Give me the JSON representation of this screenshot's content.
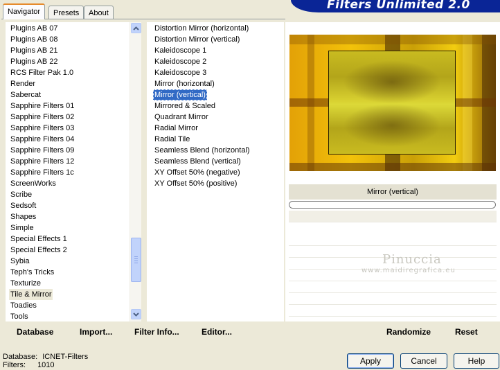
{
  "window": {
    "banner_title": "Filters Unlimited 2.0"
  },
  "tabs": [
    {
      "label": "Navigator",
      "active": true
    },
    {
      "label": "Presets",
      "active": false
    },
    {
      "label": "About",
      "active": false
    }
  ],
  "categories": {
    "items": [
      "Plugins AB 07",
      "Plugins AB 08",
      "Plugins AB 21",
      "Plugins AB 22",
      "RCS Filter Pak 1.0",
      "Render",
      "Sabercat",
      "Sapphire Filters 01",
      "Sapphire Filters 02",
      "Sapphire Filters 03",
      "Sapphire Filters 04",
      "Sapphire Filters 09",
      "Sapphire Filters 12",
      "Sapphire Filters 1c",
      "ScreenWorks",
      "Scribe",
      "Sedsoft",
      "Shapes",
      "Simple",
      "Special Effects 1",
      "Special Effects 2",
      "Sybia",
      "Teph's Tricks",
      "Texturize",
      "Tile & Mirror",
      "Toadies",
      "Tools"
    ],
    "selected": "Tile & Mirror"
  },
  "filters": {
    "items": [
      "Distortion Mirror (horizontal)",
      "Distortion Mirror (vertical)",
      "Kaleidoscope 1",
      "Kaleidoscope 2",
      "Kaleidoscope 3",
      "Mirror (horizontal)",
      "Mirror (vertical)",
      "Mirrored & Scaled",
      "Quadrant Mirror",
      "Radial Mirror",
      "Radial Tile",
      "Seamless Blend (horizontal)",
      "Seamless Blend (vertical)",
      "XY Offset 50% (negative)",
      "XY Offset 50% (positive)"
    ],
    "selected": "Mirror (vertical)"
  },
  "toolbar": {
    "database": "Database",
    "import": "Import...",
    "filter_info": "Filter Info...",
    "editor": "Editor...",
    "randomize": "Randomize",
    "reset": "Reset"
  },
  "preview": {
    "filter_name": "Mirror (vertical)"
  },
  "watermark": {
    "name": "Pinuccia",
    "site": "www.maidiregrafica.eu"
  },
  "status": {
    "database_label": "Database:",
    "database_value": "ICNET-Filters",
    "filters_label": "Filters:",
    "filters_value": "1010"
  },
  "buttons": {
    "apply": "Apply",
    "cancel": "Cancel",
    "help": "Help"
  },
  "colors": {
    "banner": "#0a2596",
    "selection": "#316ac5",
    "active_tab_accent": "#e68b2c"
  }
}
